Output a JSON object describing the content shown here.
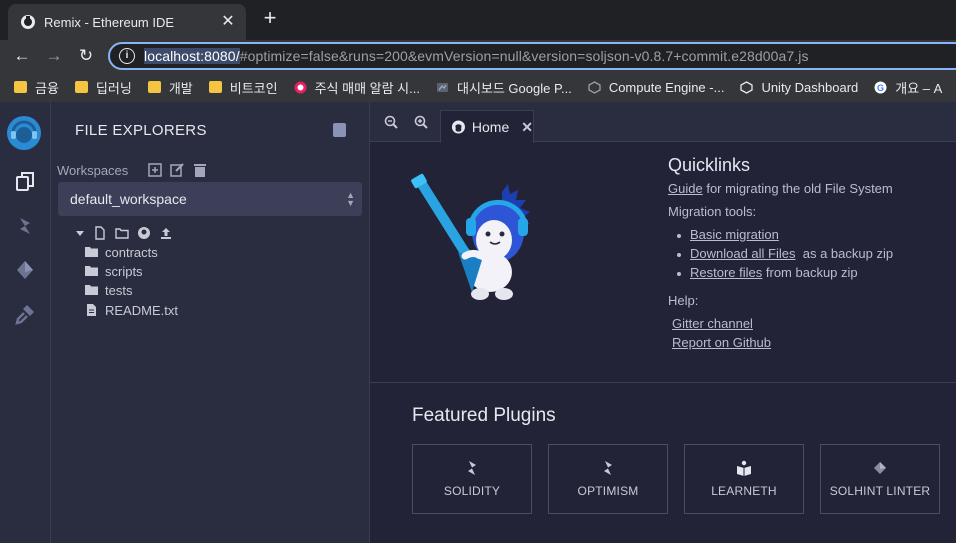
{
  "browser": {
    "tab_title": "Remix - Ethereum IDE",
    "url_host": "localhost:8080/",
    "url_rest": "#optimize=false&runs=200&evmVersion=null&version=soljson-v0.8.7+commit.e28d00a7.js",
    "bookmarks": [
      {
        "label": "금융",
        "icon": "folder-icon"
      },
      {
        "label": "딥러닝",
        "icon": "folder-icon"
      },
      {
        "label": "개발",
        "icon": "folder-icon"
      },
      {
        "label": "비트코인",
        "icon": "folder-icon"
      },
      {
        "label": "주식 매매 알람 시...",
        "icon": "alarm-icon"
      },
      {
        "label": "대시보드 Google P...",
        "icon": "gcp-icon"
      },
      {
        "label": "Compute Engine -...",
        "icon": "compute-icon"
      },
      {
        "label": "Unity Dashboard",
        "icon": "unity-icon"
      },
      {
        "label": "개요 – A",
        "icon": "google-icon"
      }
    ]
  },
  "remix": {
    "side_panel": {
      "title": "FILE EXPLORERS",
      "workspaces_label": "Workspaces",
      "workspace_selected": "default_workspace",
      "tree": [
        {
          "label": "contracts",
          "type": "folder"
        },
        {
          "label": "scripts",
          "type": "folder"
        },
        {
          "label": "tests",
          "type": "folder"
        },
        {
          "label": "README.txt",
          "type": "file"
        }
      ]
    },
    "main": {
      "home_tab_label": "Home",
      "quicklinks": {
        "title": "Quicklinks",
        "guide_link": "Guide",
        "guide_text": "for migrating the old File System",
        "migration_label": "Migration tools:",
        "basic_migration": "Basic migration",
        "download_all": "Download all Files",
        "download_suffix": "as a backup zip",
        "restore_files": "Restore files",
        "restore_suffix": "from backup zip",
        "help_label": "Help:",
        "gitter": "Gitter channel",
        "github": "Report on Github"
      },
      "featured_title": "Featured Plugins",
      "plugins": [
        {
          "label": "SOLIDITY",
          "icon": "solidity-icon"
        },
        {
          "label": "OPTIMISM",
          "icon": "optimism-icon"
        },
        {
          "label": "LEARNETH",
          "icon": "book-icon"
        },
        {
          "label": "SOLHINT LINTER",
          "icon": "solhint-icon"
        }
      ]
    }
  },
  "colors": {
    "accent": "#8ab4f8",
    "panel_bg": "#2a2c3f",
    "main_bg": "#222336",
    "folder_yellow": "#f4c542"
  }
}
